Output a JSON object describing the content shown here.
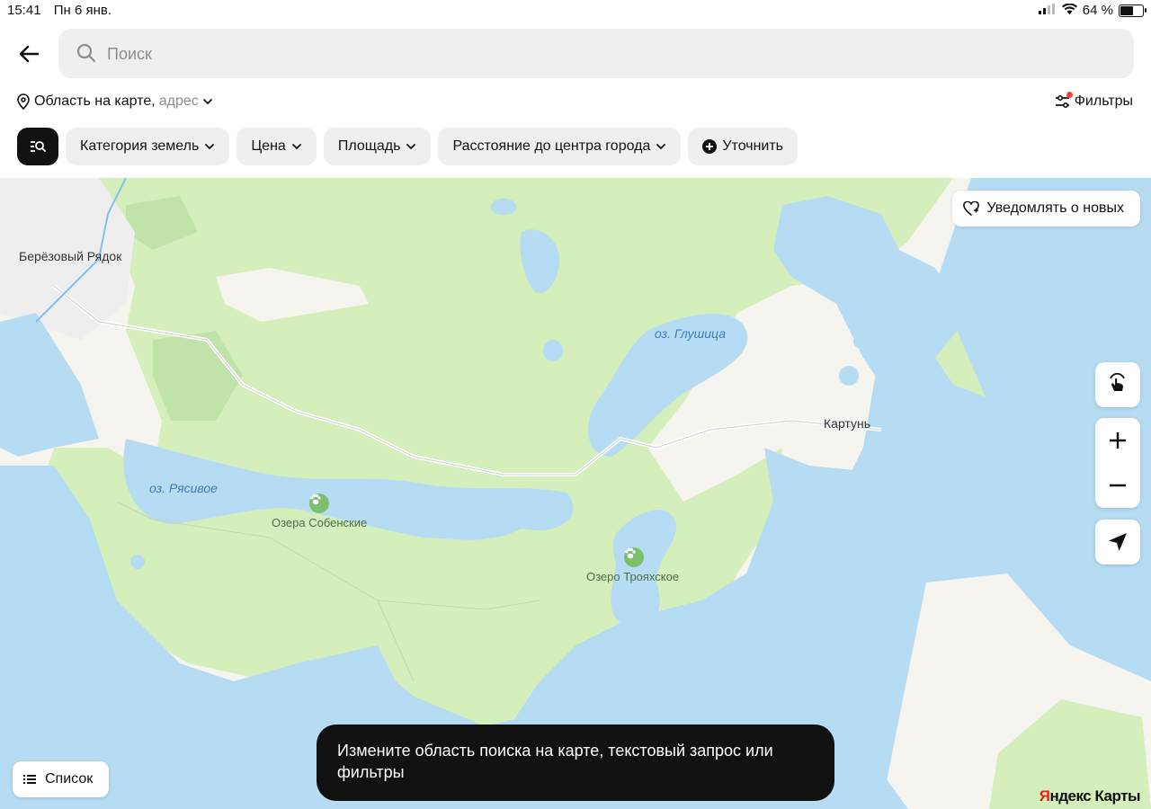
{
  "status_bar": {
    "time": "15:41",
    "date": "Пн 6 янв.",
    "battery_percent": "64 %",
    "battery_level": 0.64
  },
  "search": {
    "placeholder": "Поиск",
    "value": ""
  },
  "area": {
    "label": "Область на карте,",
    "sub": "адрес"
  },
  "filters": {
    "label": "Фильтры"
  },
  "chips": [
    {
      "label": "Категория земель"
    },
    {
      "label": "Цена"
    },
    {
      "label": "Площадь"
    },
    {
      "label": "Расстояние до центра города"
    },
    {
      "label": "Уточнить"
    }
  ],
  "map": {
    "labels": {
      "village1": "Берёзовый Рядок",
      "lake1": "оз. Глушица",
      "village2": "Картунь",
      "lake2": "оз. Рясивое",
      "park1": "Озера Собенские",
      "park2": "Озеро Трояхское"
    },
    "colors": {
      "water": "#b6dcf3",
      "forest": "#d4efbb",
      "land": "#f6f4ee"
    }
  },
  "notify": {
    "label": "Уведомлять о новых"
  },
  "list_button": {
    "label": "Список"
  },
  "toast": {
    "text": "Измените область поиска на карте, текстовый запрос или фильтры"
  },
  "brand": {
    "part1": "Я",
    "part2": "ндекс Карты"
  }
}
